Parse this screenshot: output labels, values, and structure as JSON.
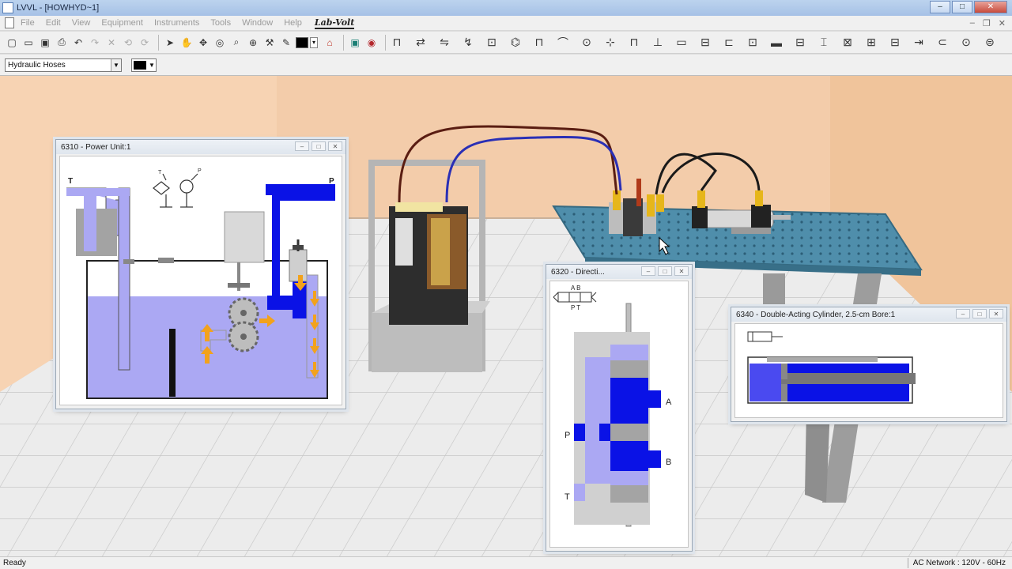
{
  "app": {
    "title": "LVVL - [HOWHYD~1]",
    "brand": "Lab-Volt"
  },
  "window_controls": {
    "minimize": "–",
    "maximize": "□",
    "close": "✕"
  },
  "menu": [
    "File",
    "Edit",
    "View",
    "Equipment",
    "Instruments",
    "Tools",
    "Window",
    "Help"
  ],
  "mdi_controls": {
    "minimize": "–",
    "restore": "❐",
    "close": "✕"
  },
  "toolbar": {
    "file_buttons": [
      "new-icon",
      "open-icon",
      "save-icon",
      "print-icon",
      "undo-icon",
      "redo-icon",
      "delete-icon",
      "rotate-left-icon",
      "rotate-right-icon"
    ],
    "tool_buttons": [
      "pointer-icon",
      "hand-icon",
      "move-icon",
      "orbit-icon",
      "zoom-icon",
      "zoom-in-icon",
      "wrench-icon",
      "pencil-icon"
    ],
    "color": "#000000",
    "component_count": 30
  },
  "hose_select": {
    "value": "Hydraulic Hoses"
  },
  "hose_color": "#000000",
  "windows": {
    "power_unit": {
      "title": "6310 - Power Unit:1",
      "label_t": "T",
      "label_p": "P",
      "sym_t": "T",
      "sym_p": "P"
    },
    "directional": {
      "title": "6320 - Directi...",
      "sym_ab": "A B",
      "sym_pt": "P T",
      "label_a": "A",
      "label_b": "B",
      "label_p": "P",
      "label_t": "T"
    },
    "cylinder": {
      "title": "6340 - Double-Acting Cylinder, 2.5-cm Bore:1"
    }
  },
  "child_controls": {
    "minimize": "–",
    "maximize": "□",
    "close": "✕"
  },
  "status": {
    "left": "Ready",
    "right": "AC Network : 120V - 60Hz"
  },
  "colors": {
    "fluid_pressure": "#0a12e6",
    "fluid_tank": "#a9a6f3",
    "arrows": "#f2a21c",
    "table": "#4e8fae",
    "floor": "#e6e6e6",
    "wall": "#f1c9a2"
  }
}
